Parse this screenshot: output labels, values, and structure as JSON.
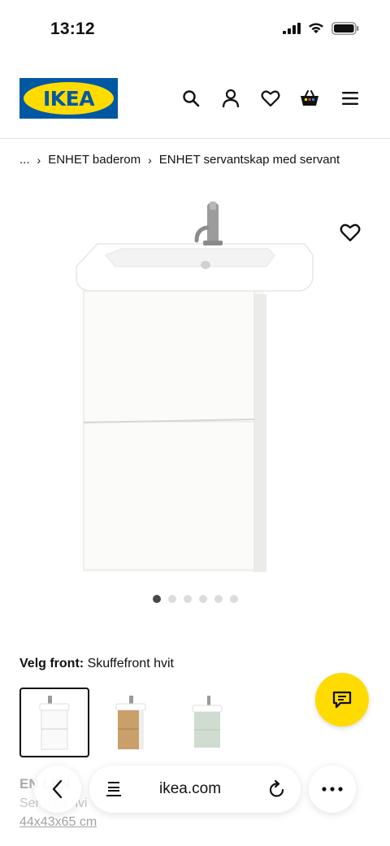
{
  "status_bar": {
    "time": "13:12"
  },
  "header": {
    "logo_text": "IKEA"
  },
  "breadcrumb": {
    "ellipsis": "...",
    "items": [
      {
        "label": "ENHET baderom"
      },
      {
        "label": "ENHET servantskap med servant"
      }
    ]
  },
  "gallery": {
    "dot_count": 6,
    "active_index": 0
  },
  "front": {
    "label": "Velg front:",
    "value": "Skuffefront hvit",
    "options": [
      {
        "color": "#ffffff",
        "selected": true
      },
      {
        "color": "#c9a06a",
        "selected": false
      },
      {
        "color": "#cfdccf",
        "selected": false
      }
    ]
  },
  "product": {
    "name_partial": "EN          LEN",
    "desc_partial": "Ser    tska                                    nvi",
    "size": "44x43x65 cm"
  },
  "browser": {
    "url": "ikea.com"
  },
  "colors": {
    "ikea_blue": "#0058a3",
    "ikea_yellow": "#ffdb00"
  }
}
